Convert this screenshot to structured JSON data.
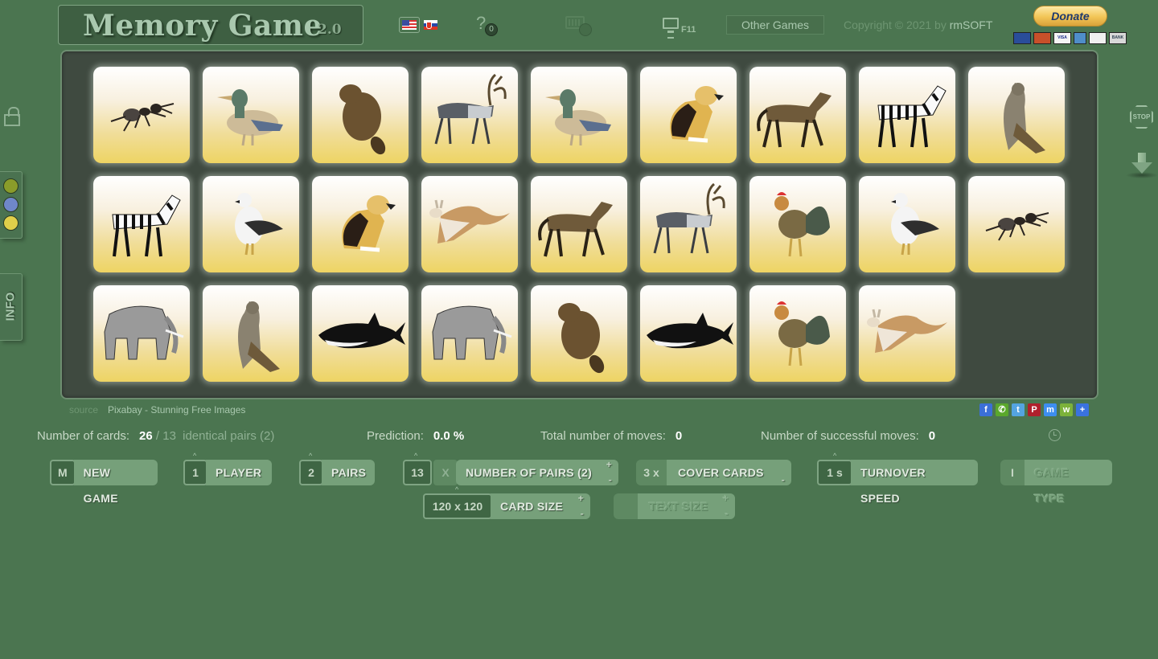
{
  "header": {
    "title": "Memory Game",
    "version": "2.0",
    "languages": [
      {
        "code": "en",
        "icon": "us-flag-icon",
        "selected": true
      },
      {
        "code": "sk",
        "icon": "slovak-flag-icon",
        "selected": false
      }
    ],
    "help_icon": "?",
    "help_count": "0",
    "fullscreen_key": "F11",
    "other_games_label": "Other Games",
    "copyright_prefix": "Copyright © 2021 by ",
    "copyright_brand": "rmSOFT",
    "donate_label": "Donate",
    "payment_methods": [
      "Maestro",
      "MasterCard",
      "VISA",
      "Amex",
      "Discover",
      "BANK"
    ]
  },
  "side": {
    "info_label": "INFO",
    "theme_colors": [
      "#8a9c2a",
      "#6f87c9",
      "#e0cf4a"
    ],
    "stop_label": "STOP"
  },
  "board": {
    "rows": [
      [
        "ant",
        "duck",
        "beaver",
        "reindeer",
        "duck",
        "beagle",
        "horse",
        "zebra",
        "falcon"
      ],
      [
        "zebra",
        "seagull",
        "beagle",
        "kangaroo",
        "horse",
        "reindeer",
        "rooster",
        "seagull",
        "ant"
      ],
      [
        "elephant",
        "falcon",
        "orca",
        "elephant",
        "beaver",
        "orca",
        "rooster",
        "kangaroo"
      ]
    ],
    "source_label": "source",
    "source_link": "Pixabay - Stunning Free Images"
  },
  "social": [
    {
      "name": "facebook",
      "glyph": "f",
      "color": "#3b6fd8"
    },
    {
      "name": "whatsapp",
      "glyph": "✆",
      "color": "#5aa82c"
    },
    {
      "name": "twitter",
      "glyph": "t",
      "color": "#54a4e0"
    },
    {
      "name": "pinterest",
      "glyph": "P",
      "color": "#b0202c"
    },
    {
      "name": "messenger",
      "glyph": "m",
      "color": "#3d8ef0"
    },
    {
      "name": "wechat",
      "glyph": "w",
      "color": "#7cb23a"
    },
    {
      "name": "more",
      "glyph": "+",
      "color": "#3a72e0"
    }
  ],
  "stats": {
    "cards_label": "Number of cards:",
    "cards_value": "26",
    "pairs_count": "13",
    "pairs_text": "identical pairs (2)",
    "prediction_label": "Prediction:",
    "prediction_value": "0.0 %",
    "total_moves_label": "Total number of moves:",
    "total_moves_value": "0",
    "successful_moves_label": "Number of successful moves:",
    "successful_moves_value": "0"
  },
  "controls": {
    "new_game": {
      "key": "M",
      "label": "NEW GAME"
    },
    "player": {
      "key": "1",
      "label": "PLAYER"
    },
    "pairs": {
      "key": "2",
      "label": "PAIRS"
    },
    "number_of_pairs": {
      "key": "13",
      "x": "X",
      "label": "NUMBER OF PAIRS (2)"
    },
    "cover_cards": {
      "key": "3 x",
      "label": "COVER CARDS"
    },
    "turnover_speed": {
      "key": "1 s",
      "label": "TURNOVER SPEED"
    },
    "game_type": {
      "key": "I",
      "label": "GAME TYPE"
    },
    "card_size": {
      "key": "120 x 120",
      "label": "CARD SIZE"
    },
    "text_size": {
      "key": "",
      "label": "TEXT SIZE"
    },
    "plus": "+",
    "minus": "-",
    "caret": "^"
  }
}
